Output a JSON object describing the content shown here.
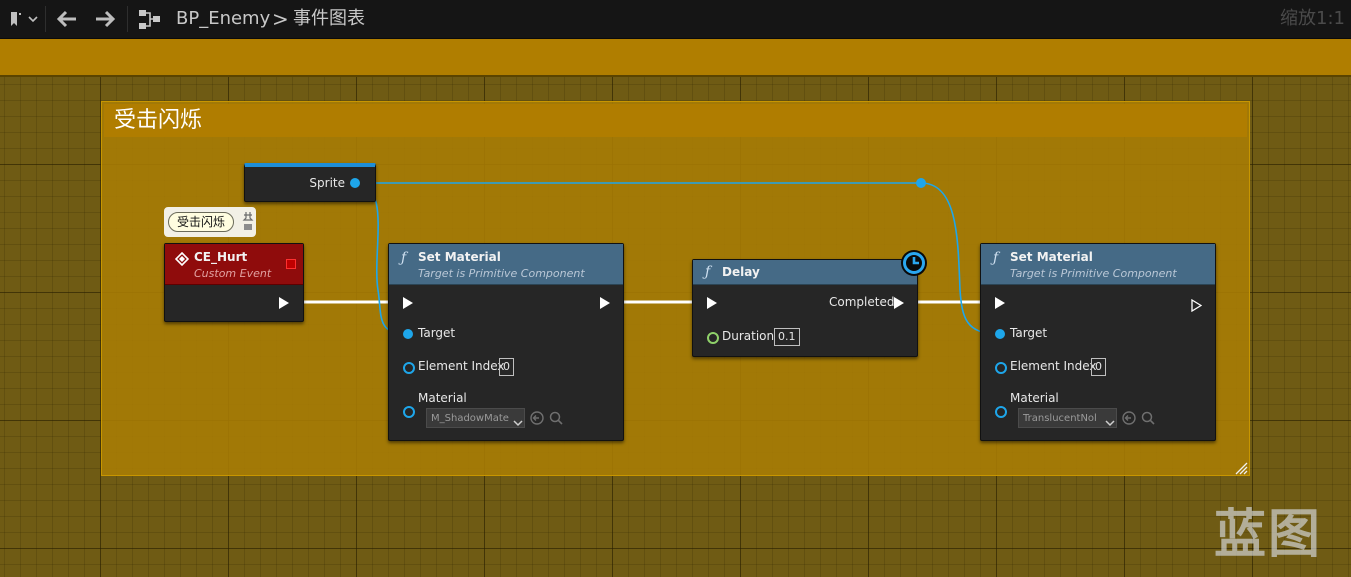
{
  "topbar": {
    "bookmark_icon": "bookmark-dropdown-icon",
    "back_icon": "back-arrow-icon",
    "forward_icon": "forward-arrow-icon",
    "graph_icon": "blueprint-graph-icon",
    "breadcrumb_asset": "BP_Enemy",
    "breadcrumb_separator": ">",
    "breadcrumb_graph": "事件图表",
    "zoom": "缩放1:1"
  },
  "comment_box": {
    "title": "受击闪烁",
    "color": "#b07d00"
  },
  "nodes": {
    "sprite_getter": {
      "output_label": "Sprite"
    },
    "custom_event": {
      "tag": "受击闪烁",
      "title": "CE_Hurt",
      "subtitle": "Custom Event",
      "header_color": "#8f0c0c"
    },
    "set_material_1": {
      "title": "Set Material",
      "subtitle": "Target is Primitive Component",
      "target_label": "Target",
      "element_index_label": "Element Index",
      "element_index_value": "0",
      "material_label": "Material",
      "material_value": "M_ShadowMate"
    },
    "delay": {
      "title": "Delay",
      "completed_label": "Completed",
      "duration_label": "Duration",
      "duration_value": "0.1"
    },
    "set_material_2": {
      "title": "Set Material",
      "subtitle": "Target is Primitive Component",
      "target_label": "Target",
      "element_index_label": "Element Index",
      "element_index_value": "0",
      "material_label": "Material",
      "material_value": "TranslucentNol"
    }
  },
  "colors": {
    "function_header": "#456a86",
    "object_pin": "#1ea6ea",
    "float_pin": "#8fd16a",
    "exec_wire": "#ffffff"
  },
  "watermark": "蓝图"
}
